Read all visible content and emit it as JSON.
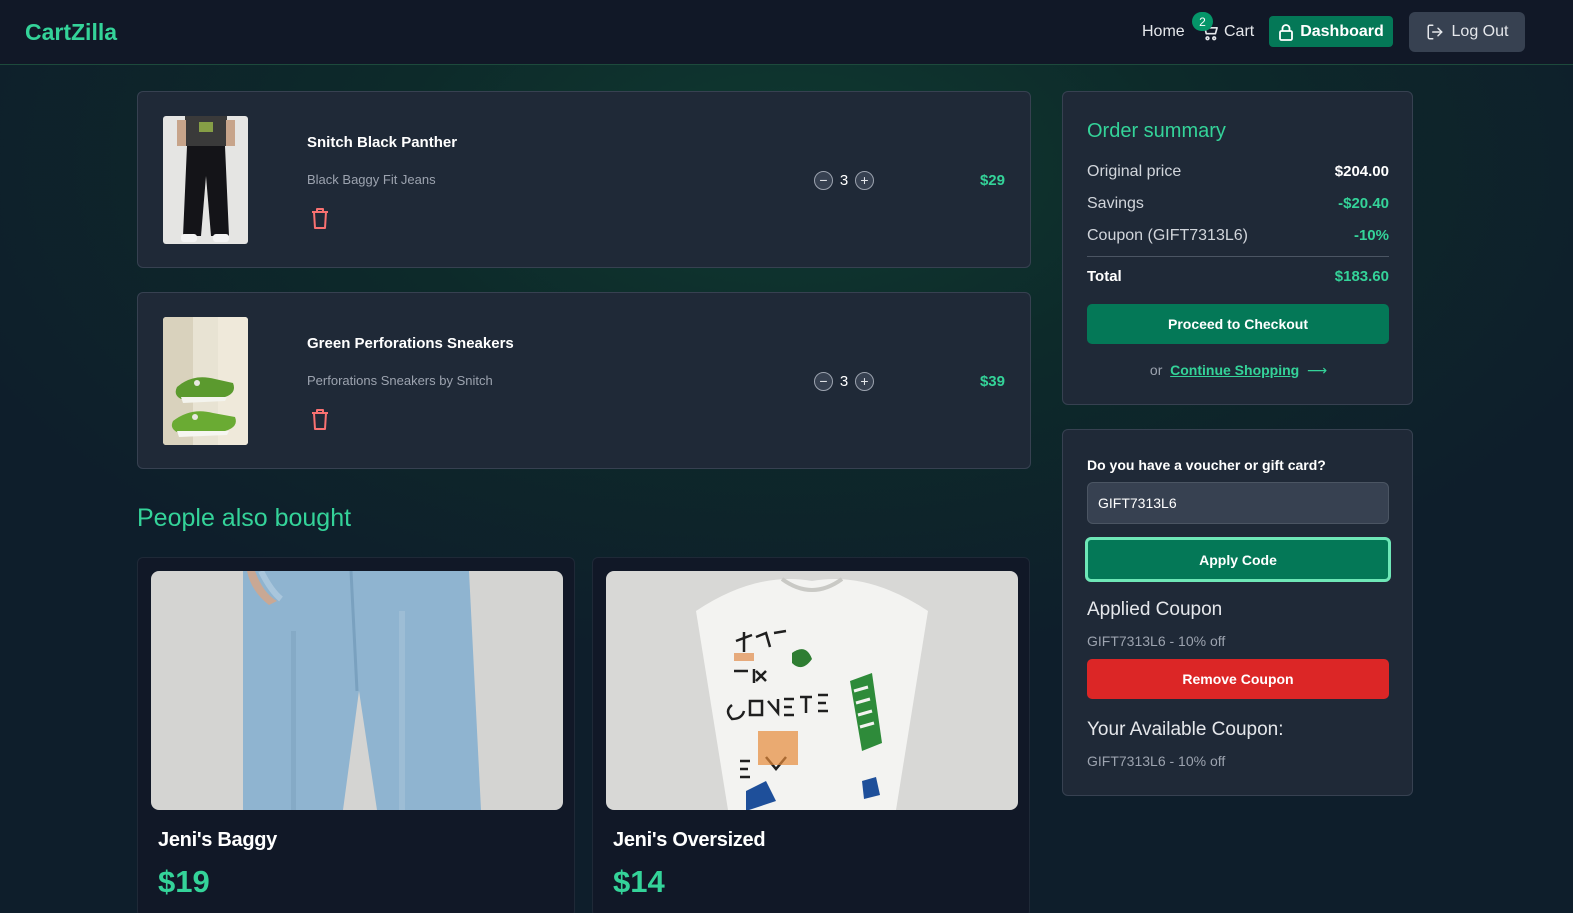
{
  "nav": {
    "logo": "CartZilla",
    "home": "Home",
    "cart": "Cart",
    "cart_count": "2",
    "dashboard": "Dashboard",
    "logout": "Log Out"
  },
  "cart_items": [
    {
      "name": "Snitch Black Panther",
      "description": "Black Baggy Fit Jeans",
      "quantity": "3",
      "price": "$29"
    },
    {
      "name": "Green Perforations Sneakers",
      "description": "Perforations Sneakers by Snitch",
      "quantity": "3",
      "price": "$39"
    }
  ],
  "recommendations": {
    "title": "People also bought",
    "items": [
      {
        "name": "Jeni's Baggy",
        "price": "$19"
      },
      {
        "name": "Jeni's Oversized",
        "price": "$14"
      }
    ]
  },
  "summary": {
    "title": "Order summary",
    "original_label": "Original price",
    "original_value": "$204.00",
    "savings_label": "Savings",
    "savings_value": "-$20.40",
    "coupon_label": "Coupon (GIFT7313L6)",
    "coupon_value": "-10%",
    "total_label": "Total",
    "total_value": "$183.60",
    "checkout": "Proceed to Checkout",
    "or": "or",
    "continue": "Continue Shopping"
  },
  "voucher": {
    "label": "Do you have a voucher or gift card?",
    "input_value": "GIFT7313L6",
    "apply": "Apply Code",
    "applied_heading": "Applied Coupon",
    "applied_text": "GIFT7313L6 - 10% off",
    "remove": "Remove Coupon",
    "available_heading": "Your Available Coupon:",
    "available_text": "GIFT7313L6 - 10% off"
  },
  "colors": {
    "accent": "#34d399",
    "button_green": "#047857",
    "danger": "#dc2626",
    "card": "#1f2937",
    "navbar": "#111827"
  }
}
